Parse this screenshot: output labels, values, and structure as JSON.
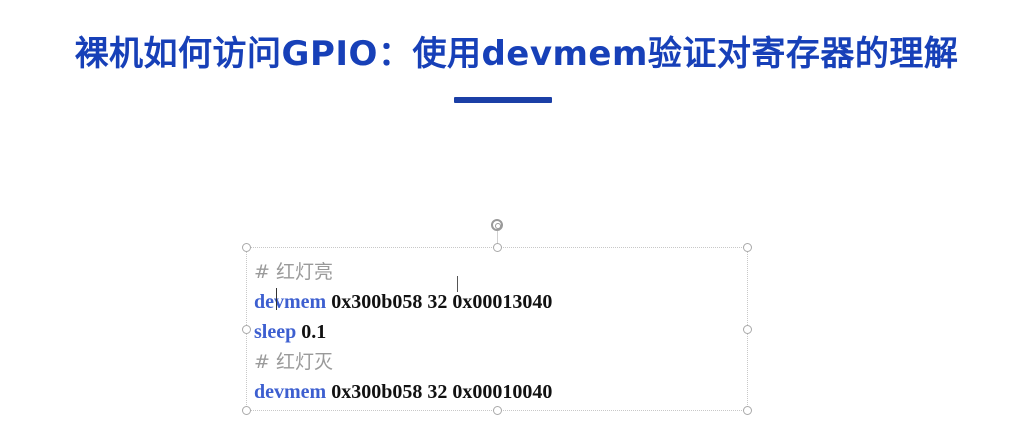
{
  "slide": {
    "title": "裸机如何访问GPIO：使用devmem验证对寄存器的理解"
  },
  "textbox": {
    "lines": [
      {
        "comment": "# 红灯亮"
      },
      {
        "cmd": "devmem",
        "args": " 0x300b058 32 0x00013040"
      },
      {
        "cmd": "sleep",
        "args": " 0.1"
      },
      {
        "comment": "# 红灯灭"
      },
      {
        "cmd": "devmem",
        "args": " 0x300b058 32 0x00010040"
      }
    ]
  },
  "colors": {
    "title": "#1740b8",
    "underline": "#1b3fa6",
    "command": "#3d5fd0",
    "comment": "#9a9a9a",
    "text": "#111111"
  },
  "icons": {
    "rotate_handle": "rotate-handle-icon",
    "resize_handle": "resize-handle-icon",
    "text_caret": "text-caret-icon",
    "ibeam_cursor": "ibeam-cursor-icon"
  }
}
